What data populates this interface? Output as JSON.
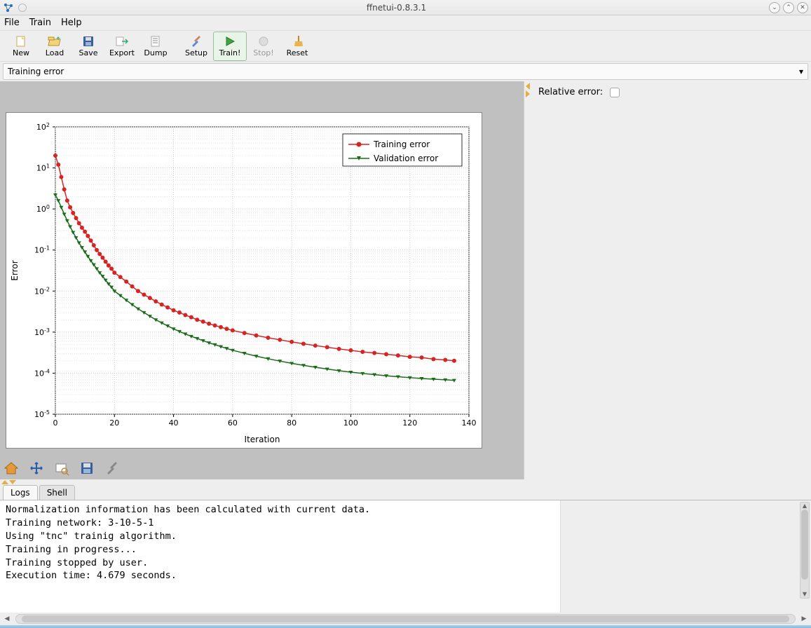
{
  "window": {
    "title": "ffnetui-0.8.3.1"
  },
  "menu": {
    "file": "File",
    "train": "Train",
    "help": "Help"
  },
  "toolbar": {
    "new": "New",
    "load": "Load",
    "save": "Save",
    "export": "Export",
    "dump": "Dump",
    "setup": "Setup",
    "train": "Train!",
    "stop": "Stop!",
    "reset": "Reset"
  },
  "dropdown": {
    "selected": "Training error"
  },
  "side": {
    "relative_error_label": "Relative error:"
  },
  "tabs": {
    "logs": "Logs",
    "shell": "Shell"
  },
  "log": {
    "l1": "Normalization information has been calculated with current data.",
    "l2": "Training network: 3-10-5-1",
    "l3": "Using \"tnc\" trainig algorithm.",
    "l4": "Training in progress...",
    "l5": "Training stopped by user.",
    "l6": "Execution time: 4.679 seconds."
  },
  "chart_data": {
    "type": "line",
    "xlabel": "Iteration",
    "ylabel": "Error",
    "xlim": [
      0,
      140
    ],
    "ylim_log10": [
      -5,
      2
    ],
    "legend": [
      "Training error",
      "Validation error"
    ],
    "x": [
      0,
      1,
      2,
      3,
      4,
      5,
      6,
      7,
      8,
      9,
      10,
      11,
      12,
      13,
      14,
      15,
      16,
      17,
      18,
      19,
      20,
      22,
      24,
      26,
      28,
      30,
      32,
      34,
      36,
      38,
      40,
      42,
      44,
      46,
      48,
      50,
      52,
      54,
      56,
      58,
      60,
      64,
      68,
      72,
      76,
      80,
      84,
      88,
      92,
      96,
      100,
      104,
      108,
      112,
      116,
      120,
      124,
      128,
      132,
      135
    ],
    "series": [
      {
        "name": "Training error",
        "values": [
          20,
          12,
          6,
          3,
          1.6,
          1.1,
          0.8,
          0.6,
          0.45,
          0.35,
          0.28,
          0.22,
          0.17,
          0.13,
          0.1,
          0.08,
          0.065,
          0.052,
          0.042,
          0.035,
          0.028,
          0.022,
          0.017,
          0.013,
          0.01,
          0.0082,
          0.0068,
          0.0056,
          0.0047,
          0.004,
          0.0034,
          0.003,
          0.0026,
          0.0023,
          0.002,
          0.0018,
          0.0016,
          0.00145,
          0.00132,
          0.0012,
          0.0011,
          0.00095,
          0.00083,
          0.00073,
          0.00065,
          0.00058,
          0.00052,
          0.00047,
          0.00043,
          0.00039,
          0.00036,
          0.00033,
          0.00031,
          0.00029,
          0.00027,
          0.00025,
          0.00024,
          0.00022,
          0.00021,
          0.0002
        ]
      },
      {
        "name": "Validation error",
        "values": [
          2.2,
          1.6,
          1.1,
          0.75,
          0.52,
          0.37,
          0.27,
          0.2,
          0.15,
          0.115,
          0.09,
          0.07,
          0.055,
          0.044,
          0.035,
          0.028,
          0.023,
          0.0185,
          0.015,
          0.0125,
          0.01,
          0.0078,
          0.006,
          0.0047,
          0.0037,
          0.003,
          0.00245,
          0.002,
          0.00168,
          0.00142,
          0.0012,
          0.00104,
          0.0009,
          0.00079,
          0.0007,
          0.00062,
          0.00055,
          0.000495,
          0.000445,
          0.0004,
          0.000362,
          0.000305,
          0.00026,
          0.000225,
          0.000197,
          0.000174,
          0.000155,
          0.000139,
          0.000126,
          0.000115,
          0.000106,
          9.85e-05,
          9.2e-05,
          8.65e-05,
          8.18e-05,
          7.78e-05,
          7.43e-05,
          7.14e-05,
          6.9e-05,
          6.7e-05
        ]
      }
    ]
  }
}
